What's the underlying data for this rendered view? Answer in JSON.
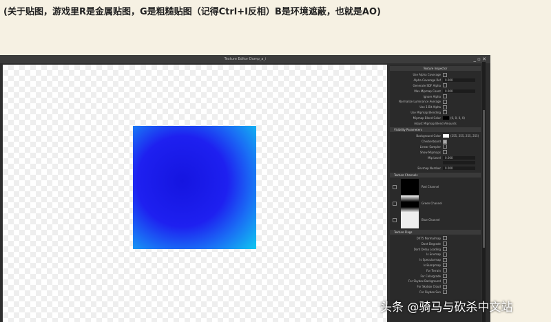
{
  "caption": "(关于贴图，游戏里R是金属贴图，G是粗糙贴图（记得Ctrl+I反相）B是环境遮蔽，也就是AO)",
  "window": {
    "title": "Texture Editor Dump_a_i",
    "controls": "_ ▫ ✕"
  },
  "inspector": {
    "title": "Texture Inspector",
    "rows": [
      {
        "label": "Use Alpha Coverage",
        "type": "check"
      },
      {
        "label": "Alpha Coverage Ref",
        "type": "value",
        "value": "0.000"
      },
      {
        "label": "Generate SDF Alpha",
        "type": "check"
      },
      {
        "label": "Max Mipmap Count",
        "type": "value",
        "value": "0.000"
      },
      {
        "label": "Ignore Alpha",
        "type": "check"
      },
      {
        "label": "Normalize Luminance Average",
        "type": "check"
      },
      {
        "label": "Use 1 Bit Alpha",
        "type": "check"
      },
      {
        "label": "Use Mipmap Blending",
        "type": "check"
      },
      {
        "label": "Mipmap Blend Color",
        "type": "color",
        "value": "(0, 0, 0, 0)",
        "color": "#000000"
      }
    ],
    "adjust": "Adjust Mipmap Blend Amounts"
  },
  "visibility": {
    "title": "Visibility Parameters",
    "rows": [
      {
        "label": "Background Color",
        "type": "color",
        "value": "(255, 255, 255, 255)",
        "color": "#ffffff"
      },
      {
        "label": "Checkerboard",
        "type": "check",
        "checked": true
      },
      {
        "label": "Linear Sampler",
        "type": "check"
      },
      {
        "label": "Show Mipmaps",
        "type": "check"
      },
      {
        "label": "Mip Level",
        "type": "value",
        "value": "0.000"
      },
      {
        "label": "",
        "type": "value",
        "value": ""
      },
      {
        "label": "Envmap Number",
        "type": "value",
        "value": "0.000"
      }
    ]
  },
  "channels": {
    "title": "Texture Channels",
    "items": [
      {
        "label": "Red Channel"
      },
      {
        "label": "Green Channel"
      },
      {
        "label": "Blue Channel"
      }
    ]
  },
  "flags": {
    "title": "Texture Flags",
    "items": [
      "DXT5 Normalmap",
      "Dont Degrade",
      "Dont Delay Loading",
      "Is Envmap",
      "Is Specularmap",
      "Is Bumpmap",
      "For Terrain",
      "For Colorgrade",
      "For Skybox Background",
      "For Skybox Cloud",
      "For Skybox Sun"
    ]
  },
  "watermark": "头条 @骑马与砍杀中文站"
}
